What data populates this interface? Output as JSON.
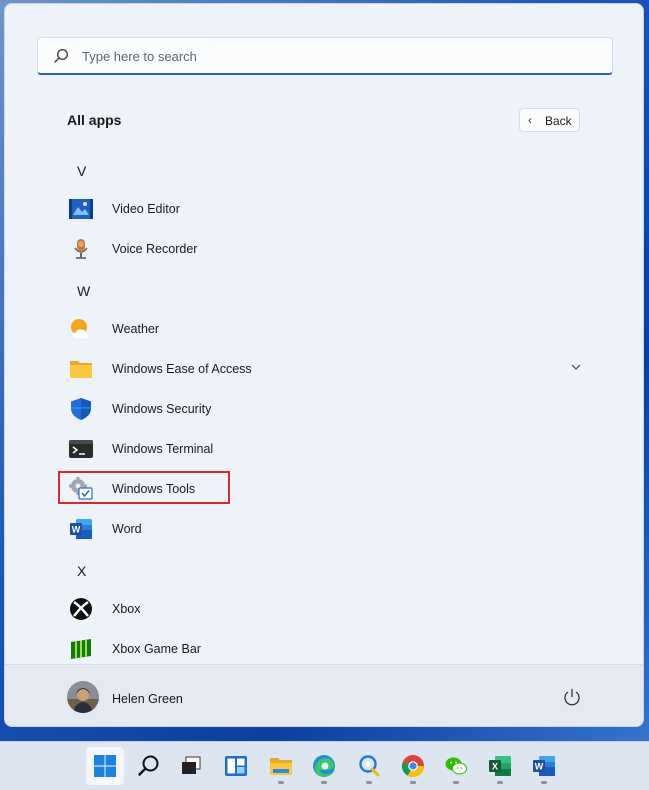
{
  "search": {
    "placeholder": "Type here to search"
  },
  "header": {
    "title": "All apps",
    "back_label": "Back"
  },
  "groups": [
    {
      "letter": "V",
      "apps": [
        "Video Editor",
        "Voice Recorder"
      ]
    },
    {
      "letter": "W",
      "apps": [
        "Weather",
        "Windows Ease of Access",
        "Windows Security",
        "Windows Terminal",
        "Windows Tools",
        "Word"
      ]
    },
    {
      "letter": "X",
      "apps": [
        "Xbox",
        "Xbox Game Bar"
      ]
    }
  ],
  "apps": {
    "video_editor": "Video Editor",
    "voice_recorder": "Voice Recorder",
    "weather": "Weather",
    "ease_of_access": "Windows Ease of Access",
    "security": "Windows Security",
    "terminal": "Windows Terminal",
    "tools": "Windows Tools",
    "word": "Word",
    "xbox": "Xbox",
    "xbox_game_bar": "Xbox Game Bar"
  },
  "highlighted_app": "Windows Tools",
  "footer": {
    "user_name": "Helen Green"
  },
  "taskbar": {
    "icons": [
      "windows-start-icon",
      "search-icon",
      "task-view-icon",
      "widgets-icon",
      "file-explorer-icon",
      "edge-icon",
      "maps-icon",
      "chrome-icon",
      "wechat-icon",
      "excel-icon",
      "word-icon"
    ]
  },
  "colors": {
    "highlight": "#e0262b",
    "accent": "#2f5fb0"
  }
}
